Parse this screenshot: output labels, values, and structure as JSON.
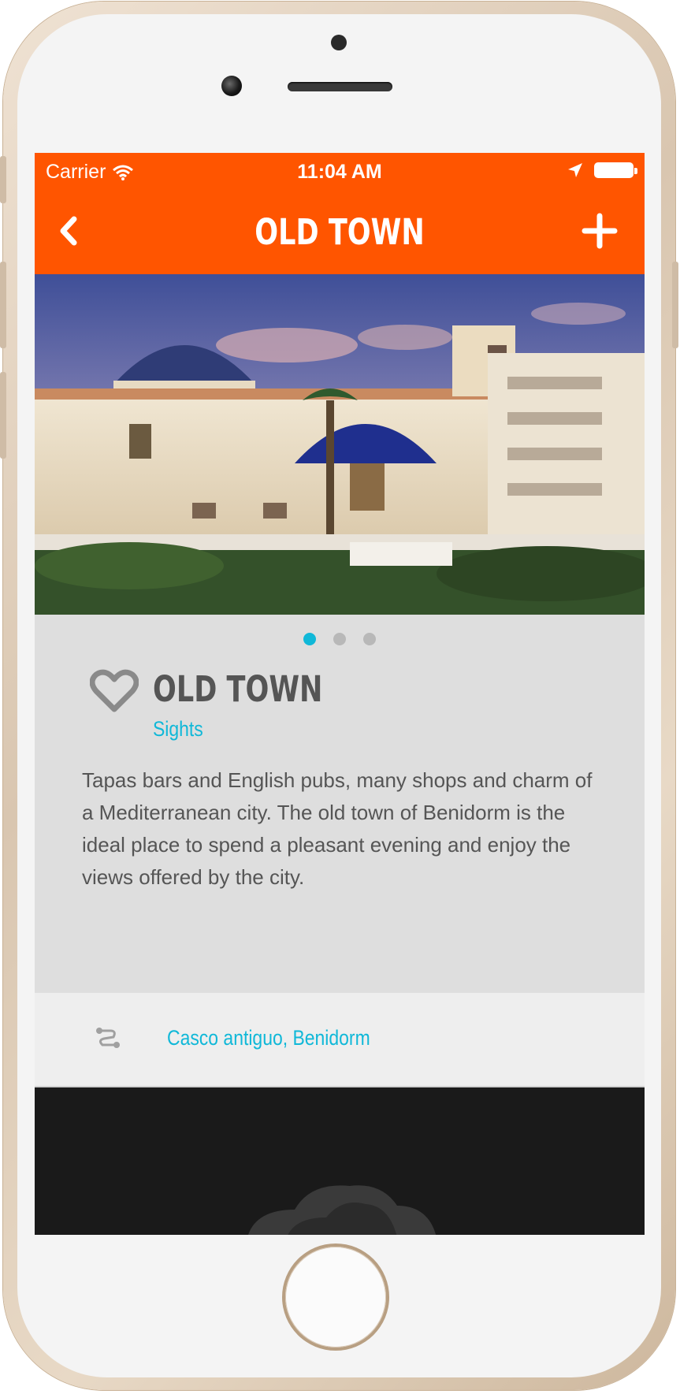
{
  "status_bar": {
    "carrier": "Carrier",
    "time": "11:04 AM"
  },
  "nav": {
    "title": "OLD TOWN",
    "back_icon": "chevron-left-icon",
    "add_icon": "plus-icon"
  },
  "gallery": {
    "image_count": 3,
    "active_index": 0
  },
  "poi": {
    "title": "OLD TOWN",
    "category": "Sights",
    "description": "Tapas bars and English pubs, many shops and charm of a Mediterranean city. The old town of Benidorm is the ideal place to spend a pleasant evening and enjoy the views offered by the city.",
    "favorite_icon": "heart-outline-icon"
  },
  "address": {
    "text": "Casco antiguo, Benidorm",
    "icon": "route-icon"
  },
  "colors": {
    "accent": "#ff5500",
    "link": "#10b8d8",
    "text": "#555555",
    "background": "#dedede"
  }
}
